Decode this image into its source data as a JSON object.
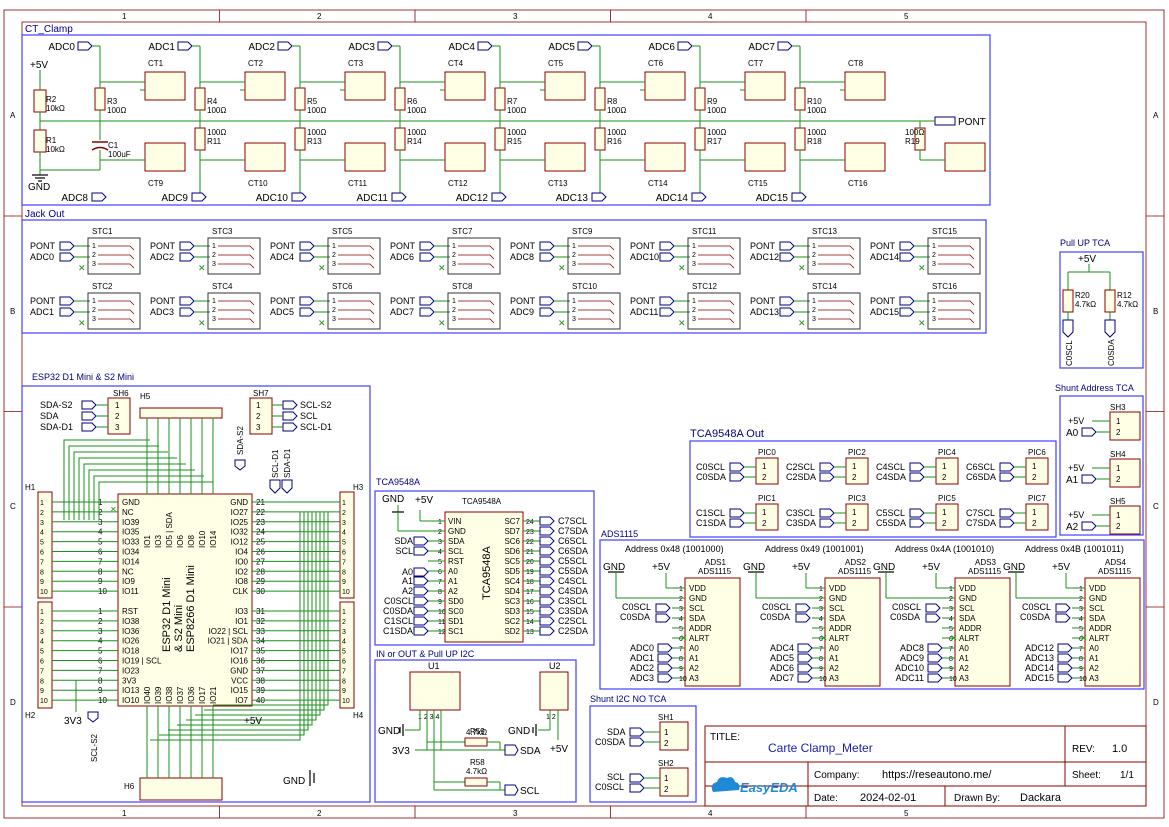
{
  "frame": {
    "columns": [
      "1",
      "2",
      "3",
      "4",
      "5"
    ],
    "rows": [
      "A",
      "B",
      "C",
      "D"
    ]
  },
  "ct_clamp": {
    "title": "CT_Clamp",
    "adc_top": [
      "ADC0",
      "ADC1",
      "ADC2",
      "ADC3",
      "ADC4",
      "ADC5",
      "ADC6",
      "ADC7"
    ],
    "adc_bottom": [
      "ADC8",
      "ADC9",
      "ADC10",
      "ADC11",
      "ADC12",
      "ADC13",
      "ADC14",
      "ADC15"
    ],
    "ct_top": [
      "CT1",
      "CT2",
      "CT3",
      "CT4",
      "CT5",
      "CT6",
      "CT7",
      "CT8"
    ],
    "ct_bottom": [
      "CT9",
      "CT10",
      "CT11",
      "CT12",
      "CT13",
      "CT14",
      "CT15",
      "CT16"
    ],
    "r_top": [
      "R3",
      "R4",
      "R5",
      "R6",
      "R7",
      "R8",
      "R9",
      "R10"
    ],
    "r_bottom": [
      "R11",
      "R13",
      "R14",
      "R15",
      "R16",
      "R17",
      "R18",
      "R19"
    ],
    "r_value": "100Ω",
    "supply": "+5V",
    "r2": "R2",
    "r2_value": "10kΩ",
    "r1": "R1",
    "r1_value": "10kΩ",
    "c1": "C1",
    "c1_value": "100uF",
    "gnd": "GND",
    "pont": "PONT"
  },
  "jack_out": {
    "title": "Jack Out",
    "jacks": [
      {
        "ref": "STC1",
        "adc": "ADC0"
      },
      {
        "ref": "STC3",
        "adc": "ADC2"
      },
      {
        "ref": "STC5",
        "adc": "ADC4"
      },
      {
        "ref": "STC7",
        "adc": "ADC6"
      },
      {
        "ref": "STC9",
        "adc": "ADC8"
      },
      {
        "ref": "STC11",
        "adc": "ADC10"
      },
      {
        "ref": "STC13",
        "adc": "ADC12"
      },
      {
        "ref": "STC15",
        "adc": "ADC14"
      },
      {
        "ref": "STC2",
        "adc": "ADC1"
      },
      {
        "ref": "STC4",
        "adc": "ADC3"
      },
      {
        "ref": "STC6",
        "adc": "ADC5"
      },
      {
        "ref": "STC8",
        "adc": "ADC7"
      },
      {
        "ref": "STC10",
        "adc": "ADC9"
      },
      {
        "ref": "STC12",
        "adc": "ADC11"
      },
      {
        "ref": "STC14",
        "adc": "ADC13"
      },
      {
        "ref": "STC16",
        "adc": "ADC15"
      }
    ],
    "pont": "PONT",
    "pins": [
      "1",
      "2",
      "3"
    ]
  },
  "pull_up": {
    "title": "Pull UP TCA",
    "supply": "+5V",
    "r20": "R20",
    "r20_value": "4.7kΩ",
    "r12": "R12",
    "r12_value": "4.7kΩ",
    "net1": "C0SCL",
    "net2": "C0SDA"
  },
  "shunt_tca": {
    "title": "Shunt Address TCA",
    "rows": [
      {
        "ref": "SH3",
        "net": "A0"
      },
      {
        "ref": "SH4",
        "net": "A1"
      },
      {
        "ref": "SH5",
        "net": "A2"
      }
    ],
    "supply": "+5V"
  },
  "esp32": {
    "title": "ESP32 D1 Mini & S2 Mini",
    "sh6": "SH6",
    "sh6_nets": [
      "SDA-S2",
      "SDA",
      "SDA-D1"
    ],
    "sh7": "SH7",
    "sh7_nets": [
      "SCL-S2",
      "SCL",
      "SCL-D1"
    ],
    "h1": "H1",
    "h2": "H2",
    "h3": "H3",
    "h4": "H4",
    "h5": "H5",
    "h6": "H6",
    "sda_s2": "SDA-S2",
    "scl_d1": "SCL-D1",
    "sda_d1": "SDA-D1",
    "scl_s2": "SCL-S2",
    "v33": "3V3",
    "v5": "+5V",
    "gnd": "GND",
    "chip_line1": "ESP32 D1 Mini",
    "chip_line2": "& S2 Mini",
    "chip_line3": "ESP8266 D1 Mini",
    "left_top": [
      "GND",
      "NC",
      "IO39",
      "IO35",
      "IO33",
      "IO34",
      "IO14",
      "NC",
      "IO9",
      "IO11"
    ],
    "left_bottom": [
      "RST",
      "IO38",
      "IO36",
      "IO26",
      "IO18",
      "IO19 | SCL",
      "IO23",
      "3V3",
      "IO13",
      "IO10"
    ],
    "right_top": [
      "GND",
      "IO27",
      "IO25",
      "IO32",
      "IO12",
      "IO4",
      "IO0",
      "IO2",
      "IO8",
      "CLK"
    ],
    "right_bottom": [
      "IO3",
      "IO1",
      "IO22 | SCL",
      "IO21 | SDA",
      "IO17",
      "IO16",
      "GND",
      "VCC",
      "IO15",
      "IO7"
    ],
    "top_pins": [
      "IO1",
      "IO3",
      "IO5 | SDA",
      "IO6",
      "IO8",
      "IO10",
      "IO14"
    ],
    "bottom_pins": [
      "IO40",
      "IO39",
      "IO38",
      "IO37",
      "IO36",
      "IO17",
      "IO21"
    ],
    "left_nums_top": [
      "1",
      "2",
      "3",
      "4",
      "5",
      "6",
      "7",
      "8",
      "9",
      "10"
    ],
    "left_nums_bottom": [
      "1",
      "2",
      "3",
      "4",
      "5",
      "6",
      "7",
      "8",
      "9",
      "10"
    ],
    "right_nums_top": [
      "21",
      "22",
      "23",
      "24",
      "25",
      "26",
      "27",
      "28",
      "29",
      "30"
    ],
    "right_nums_bottom": [
      "31",
      "32",
      "33",
      "34",
      "35",
      "36",
      "37",
      "38",
      "39",
      "40"
    ]
  },
  "tca_block": {
    "title": "TCA9548A",
    "chip_ref": "TCA9548A",
    "chip_body": "TCA9548A",
    "gnd": "GND",
    "v5": "+5V",
    "left_pins": [
      "VIN",
      "GND",
      "SDA",
      "SCL",
      "RST",
      "A0",
      "A1",
      "A2",
      "SD0",
      "SC0",
      "SD1",
      "SC1"
    ],
    "left_nets": [
      "SDA",
      "SCL",
      "A0",
      "A1",
      "A2",
      "C0SCL",
      "C0SDA",
      "C1SCL",
      "C1SDA"
    ],
    "right_pins": [
      "SC7",
      "SD7",
      "SC6",
      "SD6",
      "SC5",
      "SD5",
      "SC4",
      "SD4",
      "SC3",
      "SD3",
      "SC2",
      "SD2"
    ],
    "right_nums": [
      "24",
      "23",
      "22",
      "21",
      "20",
      "19",
      "18",
      "17",
      "16",
      "15",
      "14",
      "13"
    ],
    "right_nets": [
      "C7SCL",
      "C7SDA",
      "C6SCL",
      "C6SDA",
      "C5SCL",
      "C5SDA",
      "C4SCL",
      "C4SDA",
      "C3SCL",
      "C3SDA",
      "C2SCL",
      "C2SDA"
    ]
  },
  "tca_out": {
    "title": "TCA9548A Out",
    "pics": [
      {
        "ref": "PIC0",
        "scl": "C0SCL",
        "sda": "C0SDA"
      },
      {
        "ref": "PIC2",
        "scl": "C2SCL",
        "sda": "C2SDA"
      },
      {
        "ref": "PIC4",
        "scl": "C4SCL",
        "sda": "C4SDA"
      },
      {
        "ref": "PIC6",
        "scl": "C6SCL",
        "sda": "C6SDA"
      },
      {
        "ref": "PIC1",
        "scl": "C1SCL",
        "sda": "C1SDA"
      },
      {
        "ref": "PIC3",
        "scl": "C3SCL",
        "sda": "C3SDA"
      },
      {
        "ref": "PIC5",
        "scl": "C5SCL",
        "sda": "C5SDA"
      },
      {
        "ref": "PIC7",
        "scl": "C7SCL",
        "sda": "C7SDA"
      }
    ]
  },
  "ads_block": {
    "title": "ADS1115",
    "units": [
      {
        "addr": "Address 0x48 (1001000)",
        "ref": "ADS1",
        "part": "ADS1115",
        "adcs": [
          "ADC0",
          "ADC1",
          "ADC2",
          "ADC3"
        ]
      },
      {
        "addr": "Address 0x49 (1001001)",
        "ref": "ADS2",
        "part": "ADS1115",
        "adcs": [
          "ADC4",
          "ADC5",
          "ADC6",
          "ADC7"
        ]
      },
      {
        "addr": "Address 0x4A (1001010)",
        "ref": "ADS3",
        "part": "ADS1115",
        "adcs": [
          "ADC8",
          "ADC9",
          "ADC10",
          "ADC11"
        ]
      },
      {
        "addr": "Address 0x4B (1001011)",
        "ref": "ADS4",
        "part": "ADS1115",
        "adcs": [
          "ADC12",
          "ADC13",
          "ADC14",
          "ADC15"
        ]
      }
    ],
    "pins": [
      "VDD",
      "GND",
      "SCL",
      "SDA",
      "ADDR",
      "ALRT",
      "A0",
      "A1",
      "A2",
      "A3"
    ],
    "scl": "C0SCL",
    "sda": "C0SDA",
    "gnd": "GND",
    "v5": "+5V"
  },
  "i2c_block": {
    "title": "IN or OUT & Pull UP I2C",
    "u1": "U1",
    "u2": "U2",
    "r59": "R59",
    "r59_value": "4.7kΩ",
    "r58": "R58",
    "r58_value": "4.7kΩ",
    "sda": "SDA",
    "scl": "SCL",
    "gnd": "GND",
    "v33": "3V3",
    "v5": "+5V"
  },
  "shunt_i2c": {
    "title": "Shunt I2C NO TCA",
    "sh1": "SH1",
    "sh1_nets": [
      "SDA",
      "C0SDA"
    ],
    "sh2": "SH2",
    "sh2_nets": [
      "SCL",
      "C0SCL"
    ]
  },
  "title_block": {
    "title_label": "TITLE:",
    "title": "Carte Clamp_Meter",
    "rev_label": "REV:",
    "rev": "1.0",
    "company_label": "Company:",
    "company": "https://reseautono.me/",
    "sheet_label": "Sheet:",
    "sheet": "1/1",
    "date_label": "Date:",
    "date": "2024-02-01",
    "drawn_label": "Drawn By:",
    "drawn": "Dackara",
    "logo": "EasyEDA"
  }
}
